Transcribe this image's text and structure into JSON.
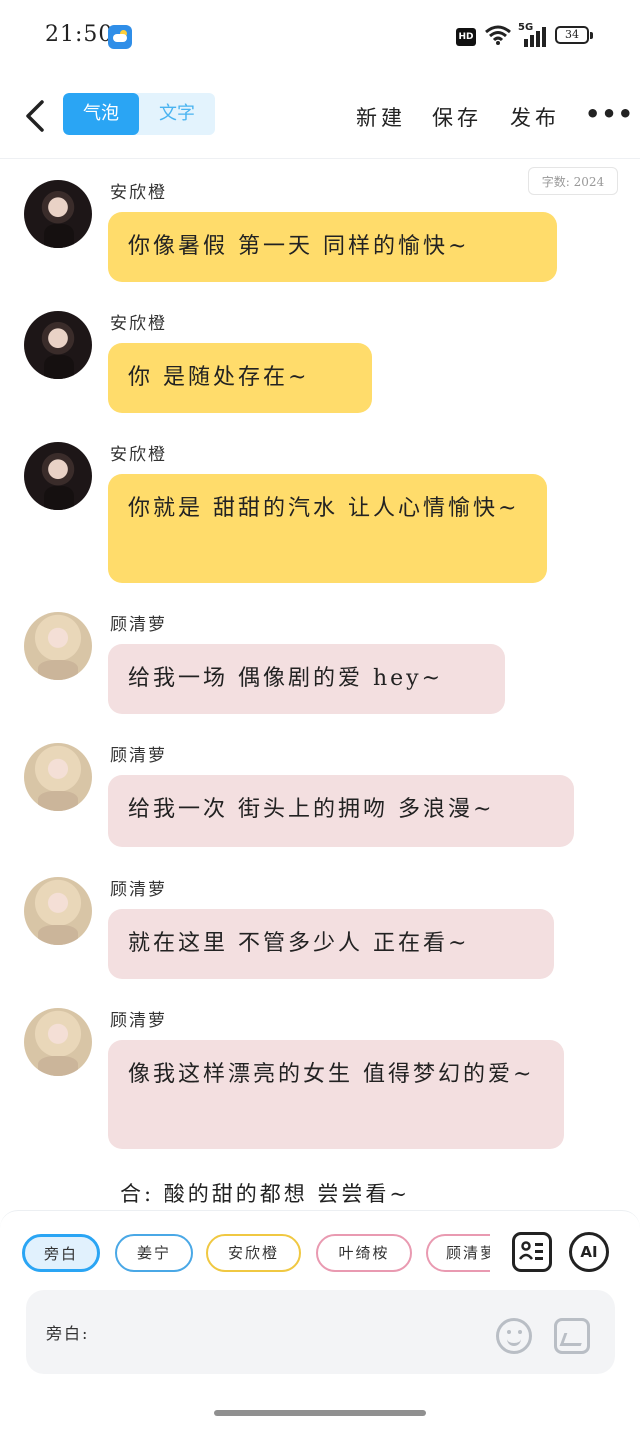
{
  "status": {
    "time": "21:50",
    "hd": "HD",
    "network": "5G",
    "battery": "34"
  },
  "nav": {
    "tab_bubble": "气泡",
    "tab_text": "文字",
    "new": "新建",
    "save": "保存",
    "publish": "发布",
    "more": "•••"
  },
  "word_count": "字数: 2024",
  "messages": [
    {
      "name": "安欣橙",
      "text": "你像暑假 第一天 同样的愉快~"
    },
    {
      "name": "安欣橙",
      "text": "你 是随处存在~"
    },
    {
      "name": "安欣橙",
      "text": "你就是 甜甜的汽水 让人心情愉快~"
    },
    {
      "name": "顾清萝",
      "text": "给我一场 偶像剧的爱 hey~"
    },
    {
      "name": "顾清萝",
      "text": "给我一次 街头上的拥吻 多浪漫~"
    },
    {
      "name": "顾清萝",
      "text": "就在这里 不管多少人 正在看~"
    },
    {
      "name": "顾清萝",
      "text": "像我这样漂亮的女生 值得梦幻的爱~"
    }
  ],
  "narration": "合: 酸的甜的都想 尝尝看~",
  "chips": [
    "旁白",
    "姜宁",
    "安欣橙",
    "叶绮桉",
    "顾清萝"
  ],
  "tools": {
    "ai": "AI"
  },
  "input": {
    "placeholder": "旁白:"
  }
}
